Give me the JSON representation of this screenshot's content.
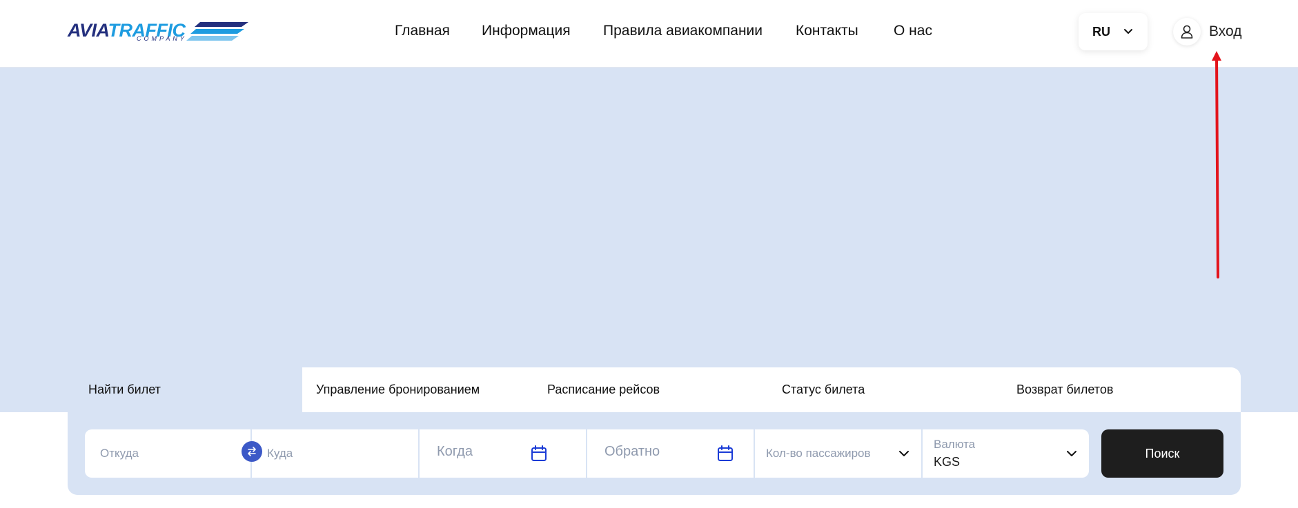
{
  "brand": {
    "logo_primary": "AVIA",
    "logo_secondary": "TRAFFIC",
    "logo_sub": "COMPANY"
  },
  "nav": {
    "items": [
      {
        "label": "Главная"
      },
      {
        "label": "Информация"
      },
      {
        "label": "Правила авиакомпании"
      },
      {
        "label": "Контакты"
      },
      {
        "label": "О нас"
      }
    ]
  },
  "header": {
    "language": "RU",
    "login_label": "Вход",
    "icons": {
      "language": "chevron-down-icon",
      "login": "user-icon"
    }
  },
  "tabs": [
    {
      "label": "Найти билет",
      "active": true
    },
    {
      "label": "Управление бронированием",
      "active": false
    },
    {
      "label": "Расписание рейсов",
      "active": false
    },
    {
      "label": "Статус билета",
      "active": false
    },
    {
      "label": "Возврат билетов",
      "active": false
    }
  ],
  "search": {
    "from_placeholder": "Откуда",
    "to_placeholder": "Куда",
    "date_placeholder": "Когда",
    "return_placeholder": "Обратно",
    "passengers_placeholder": "Кол-во пассажиров",
    "currency_label": "Валюта",
    "currency_value": "KGS",
    "submit_label": "Поиск"
  },
  "colors": {
    "hero_background": "#d8e3f4",
    "accent_blue": "#3c59c7",
    "calendar_blue": "#1a3bd6",
    "search_button": "#1e1e1e",
    "annotation_arrow": "#e3141c"
  }
}
